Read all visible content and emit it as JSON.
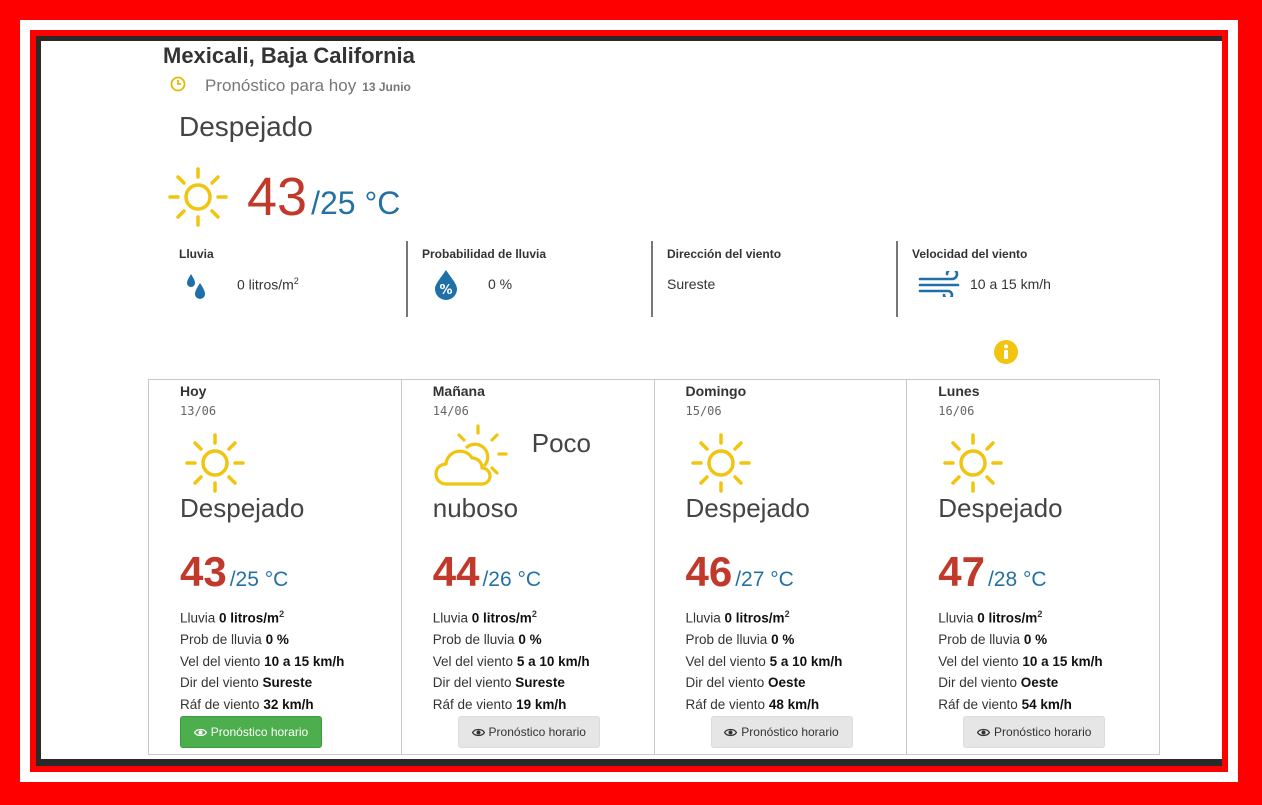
{
  "header": {
    "location": "Mexicali, Baja California",
    "forecast_label": "Pronóstico para hoy",
    "forecast_date": "13 Junio"
  },
  "current": {
    "condition": "Despejado",
    "tmax": "43",
    "tmin": "/25 °C",
    "icon": "sun-icon"
  },
  "stats": {
    "rain_label": "Lluvia",
    "rain_value": "0 litros/m",
    "rain_sup": "2",
    "prob_label": "Probabilidad de lluvia",
    "prob_value": "0 %",
    "wind_dir_label": "Dirección del viento",
    "wind_dir_value": "Sureste",
    "wind_speed_label": "Velocidad del viento",
    "wind_speed_value": "10 a 15 km/h"
  },
  "labels": {
    "rain": "Lluvia ",
    "prob": "Prob de lluvia ",
    "wind_speed": "Vel del viento ",
    "wind_dir": "Dir del viento ",
    "gust": "Ráf de viento ",
    "sup": "2",
    "button": "Pronóstico horario"
  },
  "days": [
    {
      "day": "Hoy",
      "date": "13/06",
      "cond1": "",
      "cond": "Despejado",
      "icon": "sun-icon",
      "tmax": "43",
      "tmin": "/25 °C",
      "rain": "0 litros/m",
      "prob": "0 %",
      "wind_speed": "10 a 15 km/h",
      "wind_dir": "Sureste",
      "gust": "32 km/h",
      "button_style": "green"
    },
    {
      "day": "Mañana",
      "date": "14/06",
      "cond1": "Poco",
      "cond": "nuboso",
      "icon": "partly-cloudy-icon",
      "tmax": "44",
      "tmin": "/26 °C",
      "rain": "0 litros/m",
      "prob": "0 %",
      "wind_speed": "5 a 10 km/h",
      "wind_dir": "Sureste",
      "gust": "19 km/h",
      "button_style": "grey"
    },
    {
      "day": "Domingo",
      "date": "15/06",
      "cond1": "",
      "cond": "Despejado",
      "icon": "sun-icon",
      "tmax": "46",
      "tmin": "/27 °C",
      "rain": "0 litros/m",
      "prob": "0 %",
      "wind_speed": "5 a 10 km/h",
      "wind_dir": "Oeste",
      "gust": "48 km/h",
      "button_style": "grey"
    },
    {
      "day": "Lunes",
      "date": "16/06",
      "cond1": "",
      "cond": "Despejado",
      "icon": "sun-icon",
      "tmax": "47",
      "tmin": "/28 °C",
      "rain": "0 litros/m",
      "prob": "0 %",
      "wind_speed": "10 a 15 km/h",
      "wind_dir": "Oeste",
      "gust": "54 km/h",
      "button_style": "grey"
    }
  ],
  "colors": {
    "border_red": "#ff0000",
    "tmax": "#c0392b",
    "tmin": "#2471a3",
    "icon_yellow": "#f1c40f",
    "button_green": "#4cae4c"
  }
}
